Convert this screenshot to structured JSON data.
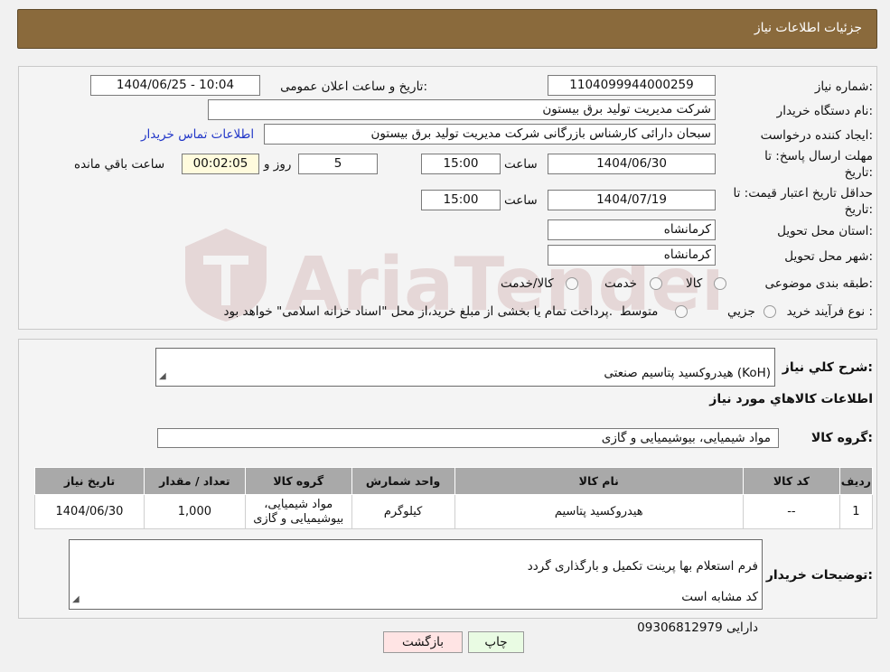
{
  "header": {
    "title": "جزئیات اطلاعات نیاز"
  },
  "fields": {
    "need_number_label": "شماره نیاز:",
    "need_number": "1104099944000259",
    "announce_label": "تاریخ و ساعت اعلان عمومی:",
    "announce_value": "1404/06/25 - 10:04",
    "buyer_org_label": "نام دستگاه خریدار:",
    "buyer_org": "شرکت مدیریت تولید برق بیستون",
    "creator_label": "ایجاد کننده درخواست:",
    "creator": "سبحان دارائی کارشناس بازرگانی شرکت مدیریت تولید برق بیستون",
    "contact_link": "اطلاعات تماس خریدار",
    "deadline_label_1": "مهلت ارسال پاسخ: تا",
    "deadline_label_2": "تاریخ:",
    "deadline_date": "1404/06/30",
    "time_label": "ساعت",
    "deadline_time": "15:00",
    "days_value": "5",
    "days_label": "روز و",
    "remaining_time": "00:02:05",
    "remaining_label": "ساعت باقي مانده",
    "validity_label_1": "حداقل تاریخ اعتبار قیمت: تا",
    "validity_label_2": "تاریخ:",
    "validity_date": "1404/07/19",
    "validity_time": "15:00",
    "province_label": "استان محل تحویل:",
    "province": "کرمانشاه",
    "city_label": "شهر محل تحویل:",
    "city": "کرمانشاه",
    "category_label": "طبقه بندی موضوعی:",
    "category_options": [
      "کالا",
      "خدمت",
      "کالا/خدمت"
    ],
    "process_label": "نوع فرآیند خرید :",
    "process_options": [
      "جزیي",
      "متوسط"
    ],
    "process_note": "پرداخت تمام یا بخشی از مبلغ خرید،از محل \"اسناد خزانه اسلامی\" خواهد بود."
  },
  "section2": {
    "summary_label": "شرح کلي نیاز:",
    "summary": "هیدروکسید پتاسیم صنعتی (KoH)",
    "items_title": "اطلاعات کالاهاي مورد نیاز",
    "group_label": "گروه کالا:",
    "group_value": "مواد شیمیایی، بیوشیمیایی و  گازی",
    "table": {
      "headers": [
        "ردیف",
        "کد کالا",
        "نام کالا",
        "واحد شمارش",
        "گروه کالا",
        "تعداد / مقدار",
        "تاریخ نیاز"
      ],
      "rows": [
        [
          "1",
          "--",
          "هیدروکسید پتاسیم",
          "کیلوگرم",
          "مواد شیمیایی، بیوشیمیایی و گازی",
          "1,000",
          "1404/06/30"
        ]
      ]
    },
    "buyer_notes_label": "توضیحات خریدار:",
    "buyer_notes_lines": [
      "فرم استعلام بها پرینت تکمیل و بارگذاری گردد",
      "کد مشابه است",
      "09306812979 دارایی"
    ]
  },
  "buttons": {
    "print": "چاپ",
    "back": "بازگشت"
  },
  "colors": {
    "header_bg": "#8a6a3c",
    "table_header_bg": "#a9a9a9",
    "timer_bg": "#fffbdd",
    "back_button_bg": "#ffe4e4",
    "print_button_bg": "#e9fbe3"
  }
}
